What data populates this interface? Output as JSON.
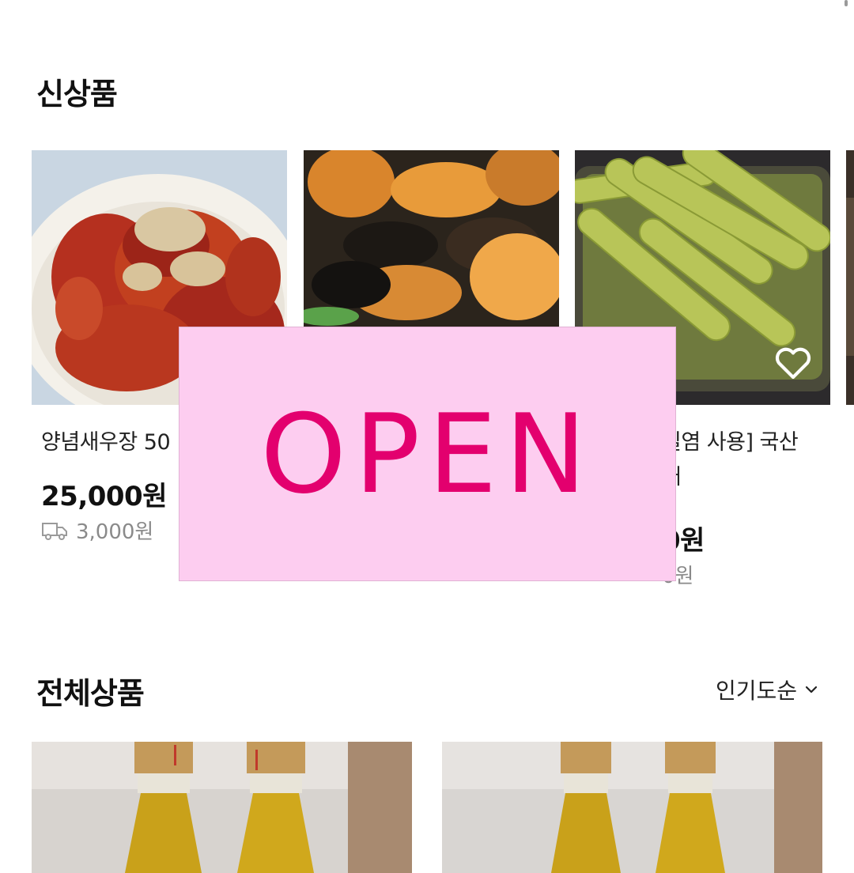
{
  "sections": {
    "new_products": {
      "title": "신상품"
    },
    "all_products": {
      "title": "전체상품",
      "sort_label": "인기도순"
    }
  },
  "new_products": [
    {
      "name": "양념새우장 50",
      "price": "25,000원",
      "shipping": "3,000원"
    },
    {
      "name": "",
      "price": "",
      "shipping": ""
    },
    {
      "name": "일염 사용] 국산\n개",
      "price": "0원",
      "shipping": "0원"
    }
  ],
  "overlay": {
    "text": "OPEN",
    "background": "#fdcdf0",
    "color": "#e3006e"
  },
  "icons": {
    "shipping": "truck-icon",
    "wish": "heart-icon",
    "sort": "chevron-down-icon"
  }
}
